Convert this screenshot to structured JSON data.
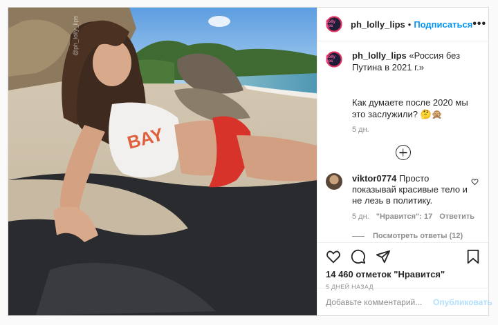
{
  "post": {
    "username": "ph_lolly_lips",
    "avatar_text": "Lolly lips",
    "follow_label": "Подписаться",
    "separator": "•",
    "more_label": "•••",
    "photo_watermark": "@ph_lolly_lips",
    "shirt_text": "BAY",
    "caption": {
      "username": "ph_lolly_lips",
      "title": "«Россия без Путина в 2021 г.»",
      "body": "Как думаете после 2020 мы это заслужили? 🤔🙊",
      "time": "5 дн."
    },
    "comment": {
      "username": "viktor0774",
      "text": "Просто показывай красивые тело и не лезь в политику.",
      "time": "5 дн.",
      "likes": "\"Нравится\": 17",
      "reply_label": "Ответить",
      "view_replies": "Посмотреть ответы (12)"
    },
    "likes_text": "14 460 отметок \"Нравится\"",
    "date_text": "5 ДНЕЙ НАЗАД",
    "comment_placeholder": "Добавьте комментарий...",
    "publish_label": "Опубликовать",
    "colors": {
      "accent": "#0095f6",
      "publish_disabled": "#b2dffc",
      "muted": "#8e8e8e"
    },
    "icons": [
      "heart-icon",
      "comment-icon",
      "share-icon",
      "bookmark-icon",
      "plus-circle-icon",
      "small-heart-icon"
    ]
  }
}
